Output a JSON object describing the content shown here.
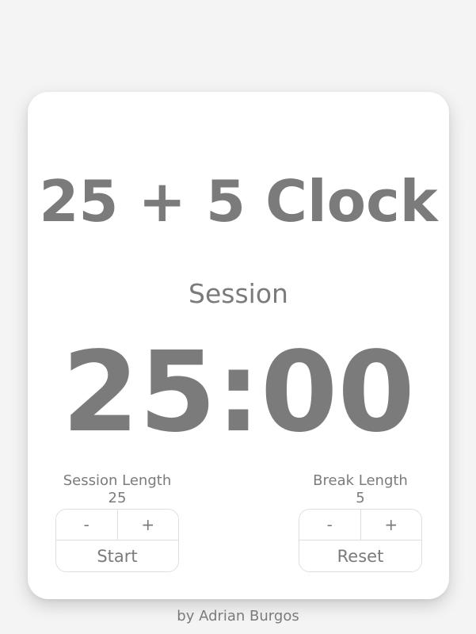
{
  "app": {
    "title": "25 + 5 Clock"
  },
  "timer": {
    "label": "Session",
    "time_left": "25:00"
  },
  "session_control": {
    "label": "Session Length",
    "value": "25",
    "decrement_label": "-",
    "increment_label": "+",
    "action_label": "Start"
  },
  "break_control": {
    "label": "Break Length",
    "value": "5",
    "decrement_label": "-",
    "increment_label": "+",
    "action_label": "Reset"
  },
  "footer": {
    "credit": "by Adrian Burgos"
  },
  "colors": {
    "background": "#f4f4f4",
    "card": "#ffffff",
    "text": "#7b7b7b",
    "border": "#dedede"
  }
}
